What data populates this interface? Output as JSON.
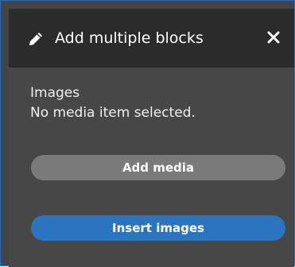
{
  "dialog": {
    "title": "Add multiple blocks",
    "title_icon": "pencil-icon",
    "close_icon": "close-icon"
  },
  "field": {
    "label": "Images",
    "status": "No media item selected."
  },
  "buttons": {
    "add_media": "Add media",
    "insert_images": "Insert images"
  },
  "colors": {
    "header_bg": "#2b2b2b",
    "body_bg": "#474747",
    "frame_border": "#2a6db5",
    "secondary_button": "#7a7a7a",
    "primary_button": "#2a74c0",
    "text": "#ffffff"
  }
}
